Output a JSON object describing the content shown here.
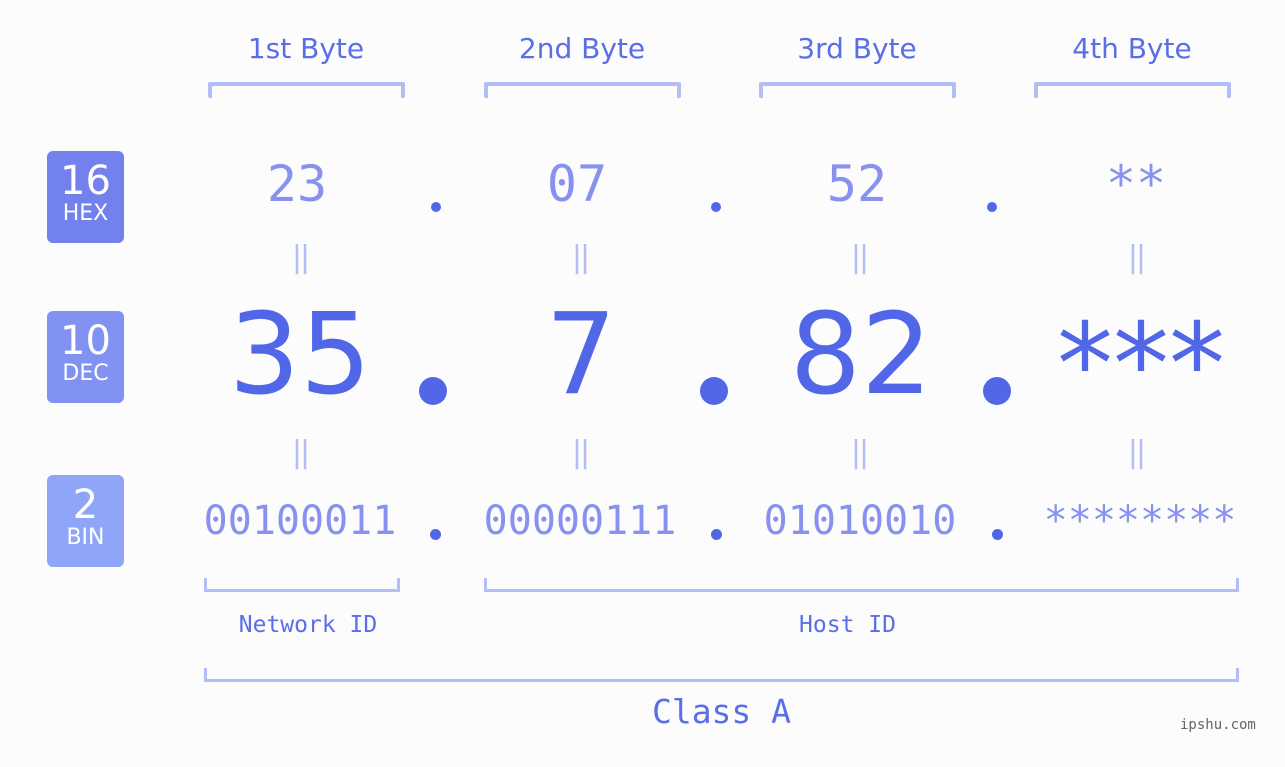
{
  "headers": [
    "1st Byte",
    "2nd Byte",
    "3rd Byte",
    "4th Byte"
  ],
  "badges": {
    "hex": {
      "num": "16",
      "label": "HEX",
      "color": "#7281ee"
    },
    "dec": {
      "num": "10",
      "label": "DEC",
      "color": "#8292f2"
    },
    "bin": {
      "num": "2",
      "label": "BIN",
      "color": "#8fa6f8"
    }
  },
  "hex": [
    "23",
    "07",
    "52",
    "**"
  ],
  "dec": [
    "35",
    "7",
    "82",
    "***"
  ],
  "bin": [
    "00100011",
    "00000111",
    "01010010",
    "********"
  ],
  "equals": "||",
  "network_id": "Network ID",
  "host_id": "Host ID",
  "class_label": "Class A",
  "watermark": "ipshu.com",
  "colors": {
    "accent": "#5267e8",
    "light": "#8892ee",
    "bracket": "#b3bdf6"
  }
}
